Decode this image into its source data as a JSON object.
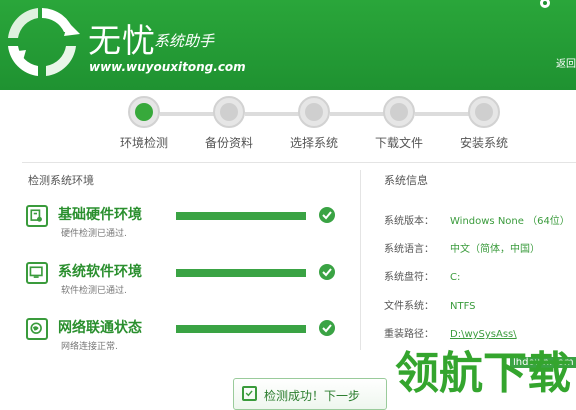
{
  "header": {
    "brand_title": "无忧",
    "brand_subtitle": "系统助手",
    "brand_url": "www.wuyouxitong.com",
    "back_label": "返回"
  },
  "steps": [
    {
      "label": "环境检测",
      "active": true
    },
    {
      "label": "备份资料",
      "active": false
    },
    {
      "label": "选择系统",
      "active": false
    },
    {
      "label": "下载文件",
      "active": false
    },
    {
      "label": "安装系统",
      "active": false
    }
  ],
  "detect": {
    "section_title": "检测系统环境",
    "items": [
      {
        "title": "基础硬件环境",
        "subtitle": "硬件检测已通过.",
        "icon": "hardware-icon",
        "progress": 1.0
      },
      {
        "title": "系统软件环境",
        "subtitle": "软件检测已通过.",
        "icon": "monitor-icon",
        "progress": 1.0
      },
      {
        "title": "网络联通状态",
        "subtitle": "网络连接正常.",
        "icon": "network-icon",
        "progress": 1.0
      }
    ]
  },
  "sysinfo": {
    "section_title": "系统信息",
    "rows": [
      {
        "key": "系统版本：",
        "value": "Windows None （64位）"
      },
      {
        "key": "系统语言：",
        "value": "中文（简体，中国）"
      },
      {
        "key": "系统盘符：",
        "value": "C:"
      },
      {
        "key": "文件系统：",
        "value": "NTFS"
      },
      {
        "key": "重装路径：",
        "value": "D:\\wySysAss\\"
      }
    ]
  },
  "next_button": {
    "label": "检测成功！下一步"
  },
  "watermark": {
    "text": "领航下载",
    "url": "lhdown.com"
  },
  "colors": {
    "brand_green": "#1f9231",
    "accent_green": "#3aa344"
  }
}
